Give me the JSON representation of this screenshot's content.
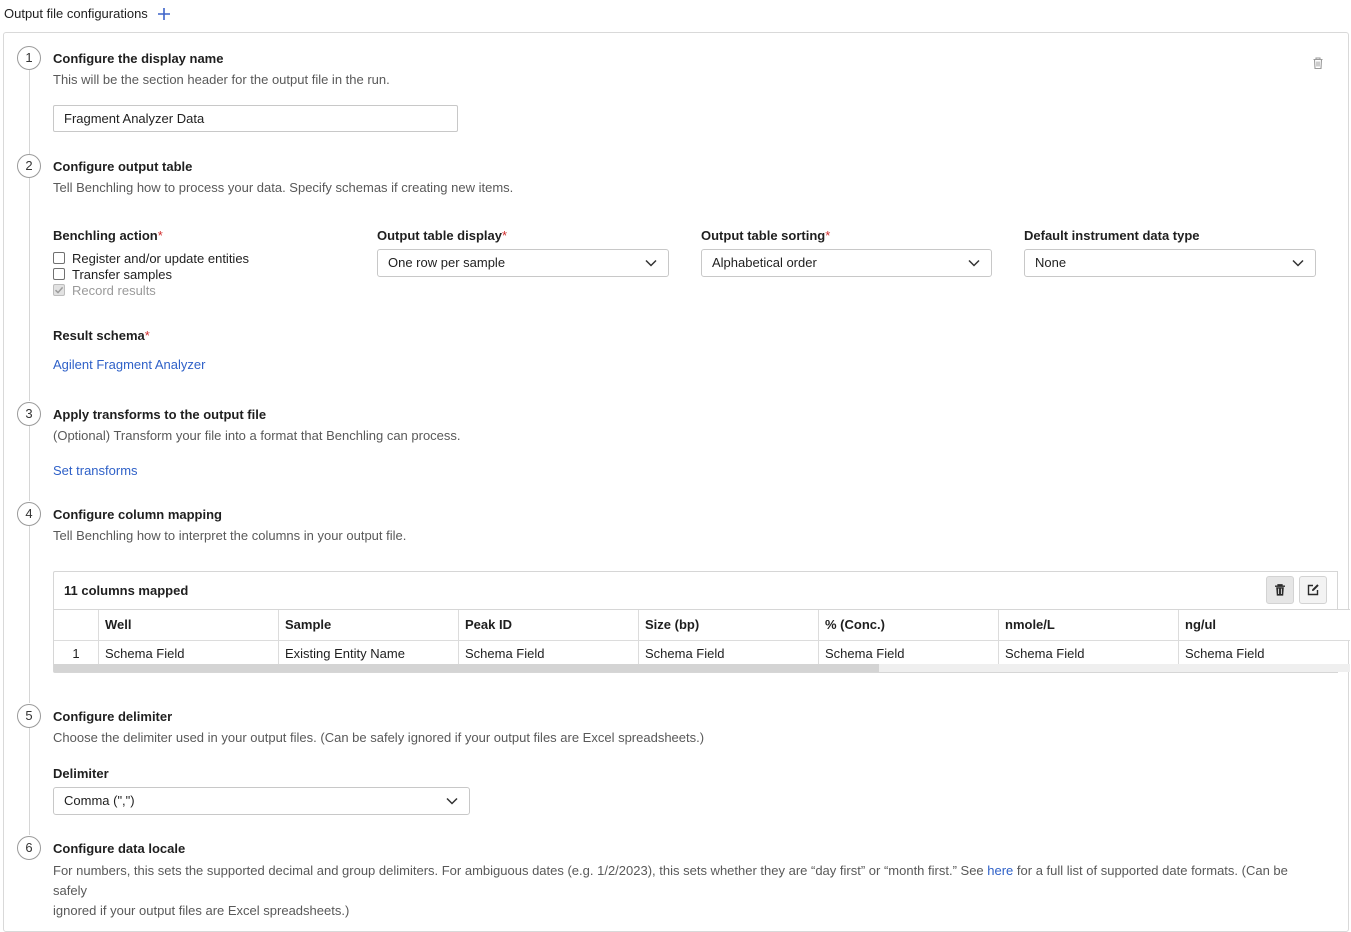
{
  "header": {
    "title": "Output file configurations"
  },
  "steps": [
    {
      "number": "1",
      "title": "Configure the display name",
      "description": "This will be the section header for the output file in the run."
    },
    {
      "number": "2",
      "title": "Configure output table",
      "description": "Tell Benchling how to process your data. Specify schemas if creating new items."
    },
    {
      "number": "3",
      "title": "Apply transforms to the output file",
      "description": "(Optional) Transform your file into a format that Benchling can process."
    },
    {
      "number": "4",
      "title": "Configure column mapping",
      "description": "Tell Benchling how to interpret the columns in your output file."
    },
    {
      "number": "5",
      "title": "Configure delimiter",
      "description": "Choose the delimiter used in your output files. (Can be safely ignored if your output files are Excel spreadsheets.)"
    },
    {
      "number": "6",
      "title": "Configure data locale"
    }
  ],
  "display_name": {
    "value": "Fragment Analyzer Data"
  },
  "output_table": {
    "benchling_action": {
      "label": "Benchling action",
      "required_mark": "*",
      "options": [
        {
          "label": "Register and/or update entities",
          "checked": false,
          "disabled": false
        },
        {
          "label": "Transfer samples",
          "checked": false,
          "disabled": false
        },
        {
          "label": "Record results",
          "checked": true,
          "disabled": true
        }
      ]
    },
    "display": {
      "label": "Output table display",
      "required_mark": "*",
      "value": "One row per sample"
    },
    "sorting": {
      "label": "Output table sorting",
      "required_mark": "*",
      "value": "Alphabetical order"
    },
    "instrument_type": {
      "label": "Default instrument data type",
      "value": "None"
    },
    "result_schema": {
      "label": "Result schema",
      "required_mark": "*",
      "link": "Agilent Fragment Analyzer"
    }
  },
  "transforms": {
    "link": "Set transforms"
  },
  "column_mapping": {
    "summary": "11 columns mapped",
    "headers": [
      "",
      "Well",
      "Sample",
      "Peak ID",
      "Size (bp)",
      "% (Conc.)",
      "nmole/L",
      "ng/ul"
    ],
    "rows": [
      [
        "1",
        "Schema Field",
        "Existing Entity Name",
        "Schema Field",
        "Schema Field",
        "Schema Field",
        "Schema Field",
        "Schema Field"
      ]
    ]
  },
  "delimiter": {
    "label": "Delimiter",
    "value": "Comma (\",\")"
  },
  "locale": {
    "desc_before": "For numbers, this sets the supported decimal and group delimiters. For ambiguous dates (e.g. 1/2/2023), this sets whether they are “day first” or “month first.” See ",
    "link": "here",
    "desc_after": " for a full list of supported date formats. (Can be safely",
    "desc_line2": "ignored if your output files are Excel spreadsheets.)"
  },
  "icons": {
    "add": "plus-icon",
    "delete": "trash-icon",
    "edit": "edit-icon",
    "dropdown": "chevron-down-icon"
  },
  "colors": {
    "accent": "#2f61c8",
    "required": "#d12c2c"
  }
}
